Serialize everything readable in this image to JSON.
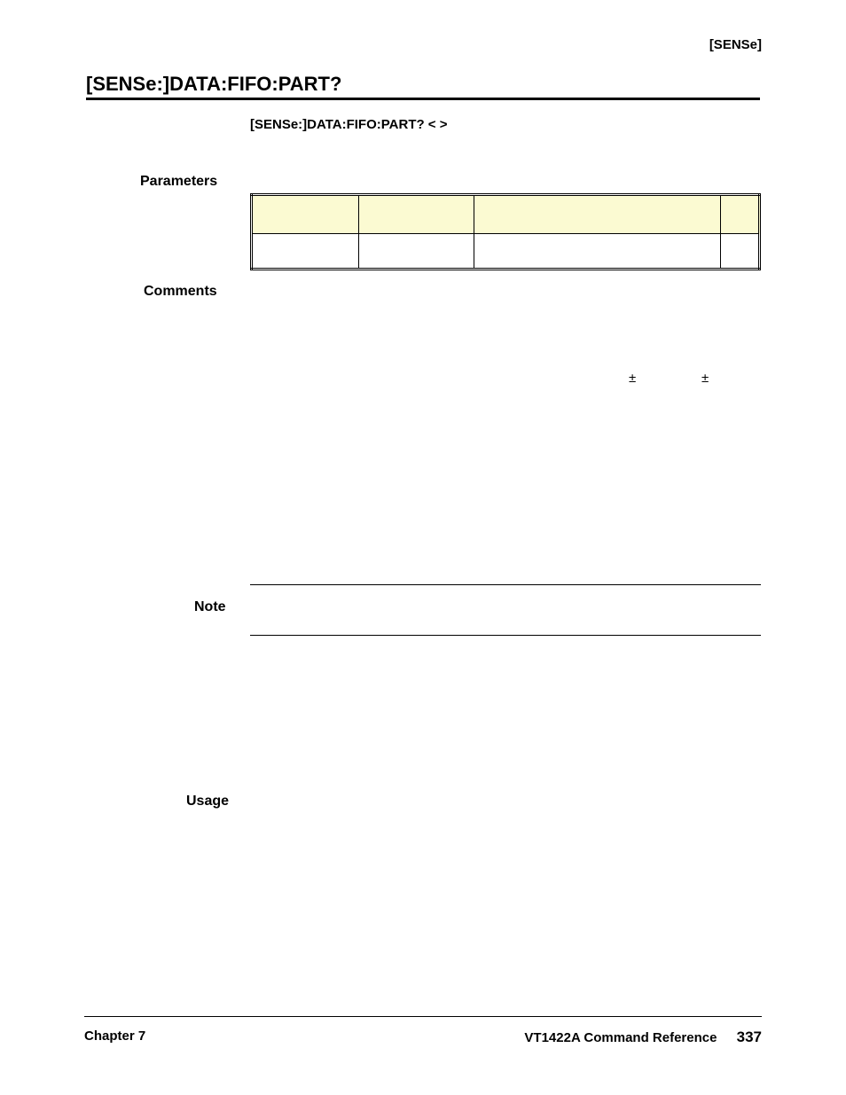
{
  "header": {
    "sense": "[SENSe]"
  },
  "heading": "[SENSe:]DATA:FIFO:PART?",
  "syntax": "[SENSe:]DATA:FIFO:PART?  <             >",
  "labels": {
    "parameters": "Parameters",
    "comments": "Comments",
    "note": "Note",
    "usage": "Usage"
  },
  "symbols": {
    "pm1": "±",
    "pm2": "±"
  },
  "footer": {
    "left": "Chapter 7",
    "right_text": "VT1422A Command Reference",
    "page": "337"
  }
}
